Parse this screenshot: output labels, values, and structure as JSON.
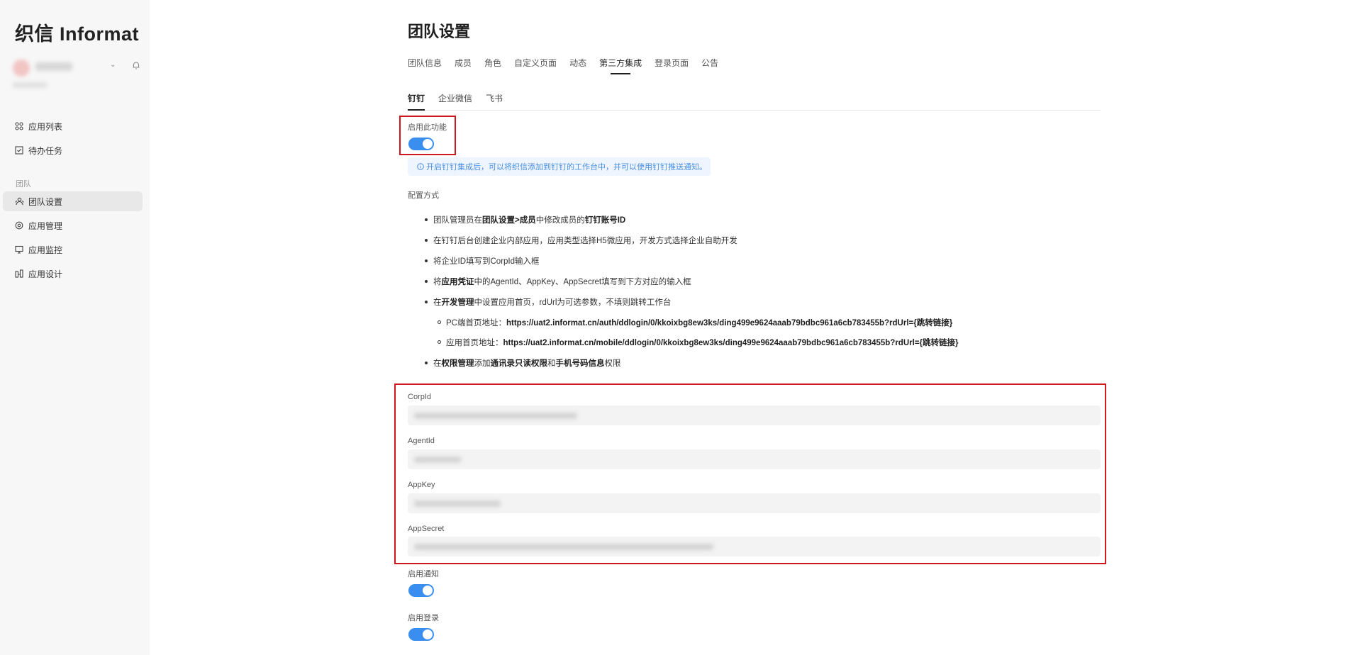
{
  "sidebar": {
    "logo": "织信 Informat",
    "nav_top": [
      {
        "label": "应用列表",
        "icon": "grid-icon"
      },
      {
        "label": "待办任务",
        "icon": "checkbox-icon"
      }
    ],
    "section_label": "团队",
    "nav_team": [
      {
        "label": "团队设置",
        "icon": "team-icon",
        "active": true
      },
      {
        "label": "应用管理",
        "icon": "gear-icon"
      },
      {
        "label": "应用监控",
        "icon": "monitor-icon"
      },
      {
        "label": "应用设计",
        "icon": "design-icon"
      }
    ]
  },
  "main": {
    "title": "团队设置",
    "tabs": [
      "团队信息",
      "成员",
      "角色",
      "自定义页面",
      "动态",
      "第三方集成",
      "登录页面",
      "公告"
    ],
    "active_tab": "第三方集成",
    "subtabs": [
      "钉钉",
      "企业微信",
      "飞书"
    ],
    "active_subtab": "钉钉",
    "enable_label": "启用此功能",
    "info_text": "开启钉钉集成后，可以将织信添加到钉钉的工作台中，并可以使用钉钉推送通知。",
    "config_label": "配置方式",
    "steps": {
      "s1_a": "团队管理员在",
      "s1_b": "团队设置>成员",
      "s1_c": "中修改成员的",
      "s1_d": "钉钉账号ID",
      "s2": "在钉钉后台创建企业内部应用，应用类型选择H5微应用，开发方式选择企业自助开发",
      "s3": "将企业ID填写到CorpId输入框",
      "s4_a": "将",
      "s4_b": "应用凭证",
      "s4_c": "中的AgentId、AppKey、AppSecret填写到下方对应的输入框",
      "s5_a": "在",
      "s5_b": "开发管理",
      "s5_c": "中设置应用首页，rdUrl为可选参数，不填则跳转工作台",
      "pc_label": "PC端首页地址：",
      "pc_url": "https://uat2.informat.cn/auth/ddlogin/0/kkoixbg8ew3ks/ding499e9624aaab79bdbc961a6cb783455b?rdUrl={跳转链接}",
      "mobile_label": "应用首页地址：",
      "mobile_url": "https://uat2.informat.cn/mobile/ddlogin/0/kkoixbg8ew3ks/ding499e9624aaab79bdbc961a6cb783455b?rdUrl={跳转链接}",
      "s6_a": "在",
      "s6_b": "权限管理",
      "s6_c": "添加",
      "s6_d": "通讯录只读权限",
      "s6_e": "和",
      "s6_f": "手机号码信息",
      "s6_g": "权限"
    },
    "fields": {
      "corpid_label": "CorpId",
      "agentid_label": "AgentId",
      "appkey_label": "AppKey",
      "appsecret_label": "AppSecret"
    },
    "enable_notify_label": "启用通知",
    "enable_login_label": "启用登录",
    "colors": {
      "accent": "#3a8ef0",
      "highlight": "#d0161e",
      "banner_bg": "#eef5fe"
    }
  }
}
